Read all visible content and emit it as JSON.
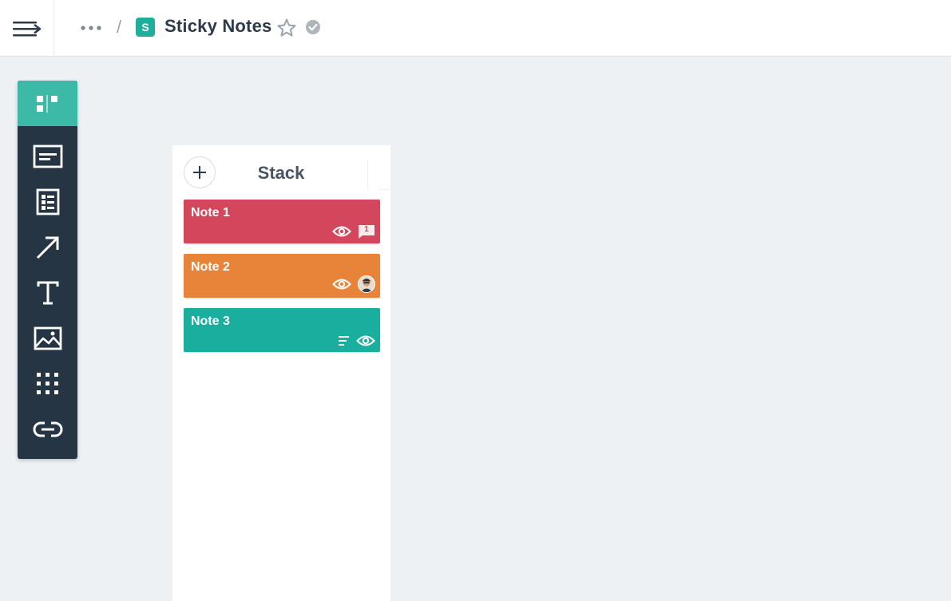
{
  "header": {
    "more_label": "•••",
    "separator": "/",
    "board_badge": "S",
    "board_title": "Sticky Notes",
    "board_color": "#1fae9b"
  },
  "toolbar": {
    "tools": [
      {
        "icon": "board-column-icon",
        "active": true
      },
      {
        "icon": "card-icon",
        "active": false
      },
      {
        "icon": "list-icon",
        "active": false
      },
      {
        "icon": "arrow-icon",
        "active": false
      },
      {
        "icon": "text-icon",
        "active": false
      },
      {
        "icon": "image-icon",
        "active": false
      },
      {
        "icon": "grid-icon",
        "active": false
      },
      {
        "icon": "link-icon",
        "active": false
      }
    ],
    "background": "#263543",
    "active_color": "#3dbaa7"
  },
  "column": {
    "title": "Stack",
    "notes": [
      {
        "title": "Note 1",
        "color": "#d4465c",
        "icons": [
          "eye-icon",
          "comment-icon"
        ],
        "comment_count": "1"
      },
      {
        "title": "Note 2",
        "color": "#e8843a",
        "icons": [
          "eye-icon",
          "avatar"
        ]
      },
      {
        "title": "Note 3",
        "color": "#1aae9f",
        "icons": [
          "description-icon",
          "eye-icon"
        ]
      }
    ]
  }
}
